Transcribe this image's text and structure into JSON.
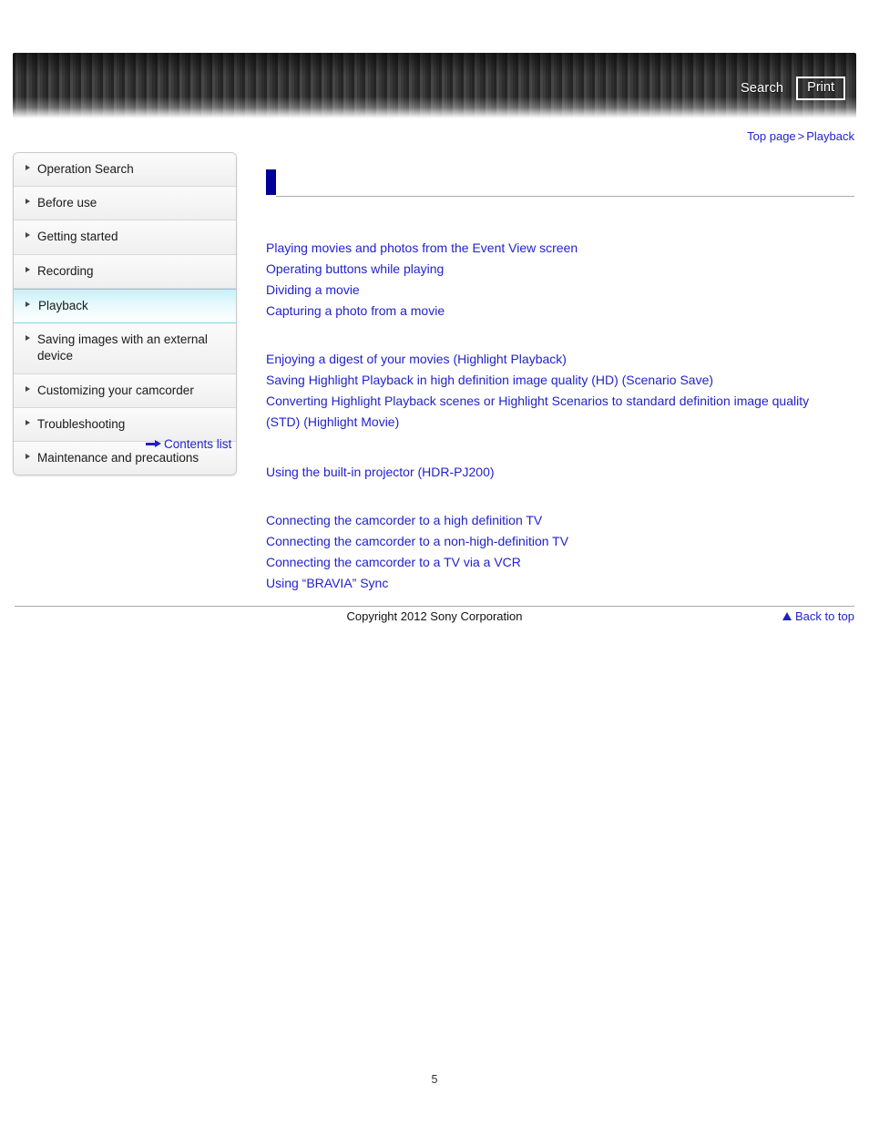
{
  "header": {
    "search_label": "Search",
    "print_label": "Print"
  },
  "breadcrumb": {
    "top_page": "Top page",
    "separator": ">",
    "current": "Playback"
  },
  "sidebar": {
    "items": [
      {
        "label": "Operation Search",
        "active": false
      },
      {
        "label": "Before use",
        "active": false
      },
      {
        "label": "Getting started",
        "active": false
      },
      {
        "label": "Recording",
        "active": false
      },
      {
        "label": "Playback",
        "active": true
      },
      {
        "label": "Saving images with an external device",
        "active": false
      },
      {
        "label": "Customizing your camcorder",
        "active": false
      },
      {
        "label": "Troubleshooting",
        "active": false
      },
      {
        "label": "Maintenance and precautions",
        "active": false
      }
    ],
    "contents_list_label": "Contents list"
  },
  "main": {
    "heading": "",
    "groups": [
      {
        "links": [
          "Playing movies and photos from the Event View screen",
          "Operating buttons while playing",
          "Dividing a movie",
          "Capturing a photo from a movie"
        ]
      },
      {
        "links": [
          "Enjoying a digest of your movies (Highlight Playback)",
          "Saving Highlight Playback in high definition image quality (HD) (Scenario Save)",
          "Converting Highlight Playback scenes or Highlight Scenarios to standard definition image quality (STD) (Highlight Movie)"
        ]
      },
      {
        "links": [
          "Using the built-in projector (HDR-PJ200)"
        ]
      },
      {
        "links": [
          "Connecting the camcorder to a high definition TV",
          "Connecting the camcorder to a non-high-definition TV",
          "Connecting the camcorder to a TV via a VCR",
          "Using “BRAVIA” Sync"
        ]
      }
    ],
    "back_to_top_label": "Back to top"
  },
  "footer": {
    "copyright": "Copyright 2012 Sony Corporation",
    "page_number": "5"
  },
  "colors": {
    "link": "#2222cc",
    "heading": "#000099",
    "active_nav": "#c8f0f8"
  }
}
